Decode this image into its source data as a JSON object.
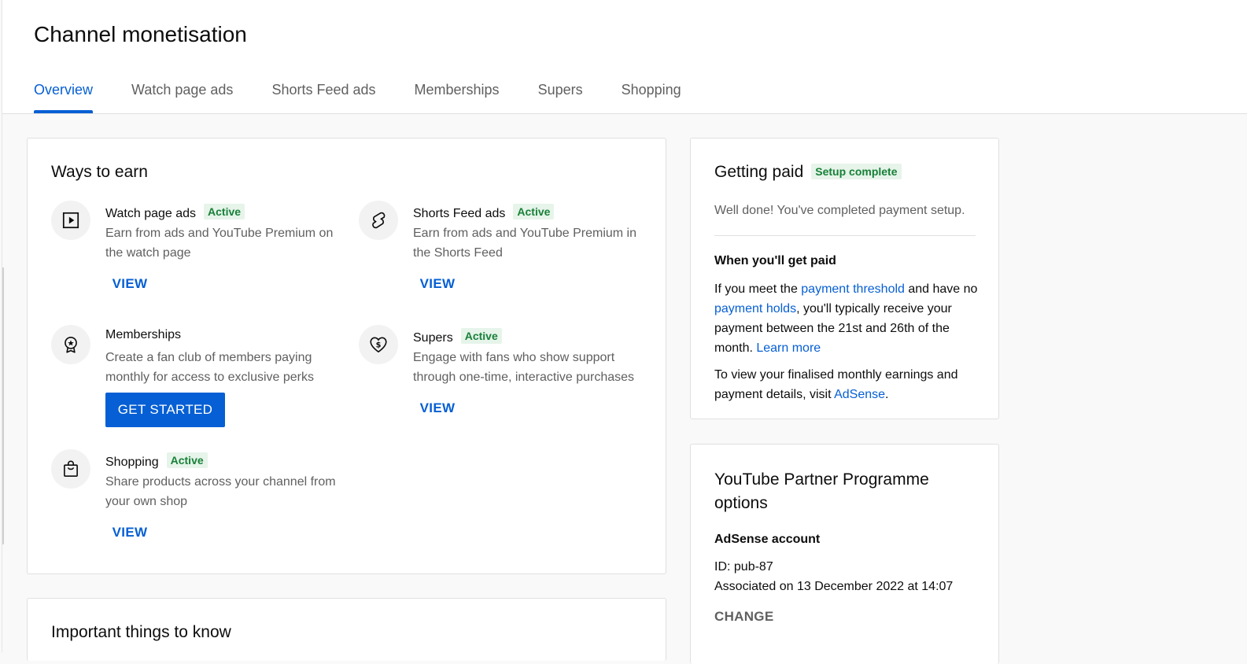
{
  "page": {
    "title": "Channel monetisation",
    "tabs": [
      {
        "label": "Overview",
        "active": true
      },
      {
        "label": "Watch page ads",
        "active": false
      },
      {
        "label": "Shorts Feed ads",
        "active": false
      },
      {
        "label": "Memberships",
        "active": false
      },
      {
        "label": "Supers",
        "active": false
      },
      {
        "label": "Shopping",
        "active": false
      }
    ]
  },
  "ways_to_earn": {
    "title": "Ways to earn",
    "items": [
      {
        "name": "Watch page ads",
        "status": "Active",
        "desc": "Earn from ads and YouTube Premium on the watch page",
        "action": "VIEW",
        "icon": "play-square-icon"
      },
      {
        "name": "Shorts Feed ads",
        "status": "Active",
        "desc": "Earn from ads and YouTube Premium in the Shorts Feed",
        "action": "VIEW",
        "icon": "shorts-icon"
      },
      {
        "name": "Memberships",
        "status": "",
        "desc": "Create a fan club of members paying monthly for access to exclusive perks",
        "action": "GET STARTED",
        "icon": "badge-star-icon"
      },
      {
        "name": "Supers",
        "status": "Active",
        "desc": "Engage with fans who show support through one-time, interactive purchases",
        "action": "VIEW",
        "icon": "heart-dollar-icon"
      },
      {
        "name": "Shopping",
        "status": "Active",
        "desc": "Share products across your channel from your own shop",
        "action": "VIEW",
        "icon": "shopping-bag-icon"
      }
    ]
  },
  "important": {
    "title": "Important things to know"
  },
  "getting_paid": {
    "title": "Getting paid",
    "badge": "Setup complete",
    "done_text": "Well done! You've completed payment setup.",
    "when_title": "When you'll get paid",
    "p1_a": "If you meet the ",
    "p1_link1": "payment threshold",
    "p1_b": " and have no ",
    "p1_link2": "payment holds",
    "p1_c": ", you'll typically receive your payment between the 21st and 26th of the month. ",
    "p1_link3": "Learn more",
    "p2_a": "To view your finalised monthly earnings and payment details, visit ",
    "p2_link": "AdSense",
    "p2_b": "."
  },
  "ypp": {
    "title": "YouTube Partner Programme options",
    "adsense_title": "AdSense account",
    "id_label": "ID: pub-87",
    "associated": "Associated on 13 December 2022 at 14:07",
    "change": "CHANGE"
  },
  "colors": {
    "accent": "#065fd4",
    "active_badge_bg": "#e6f4ea",
    "active_badge_text": "#188038"
  }
}
